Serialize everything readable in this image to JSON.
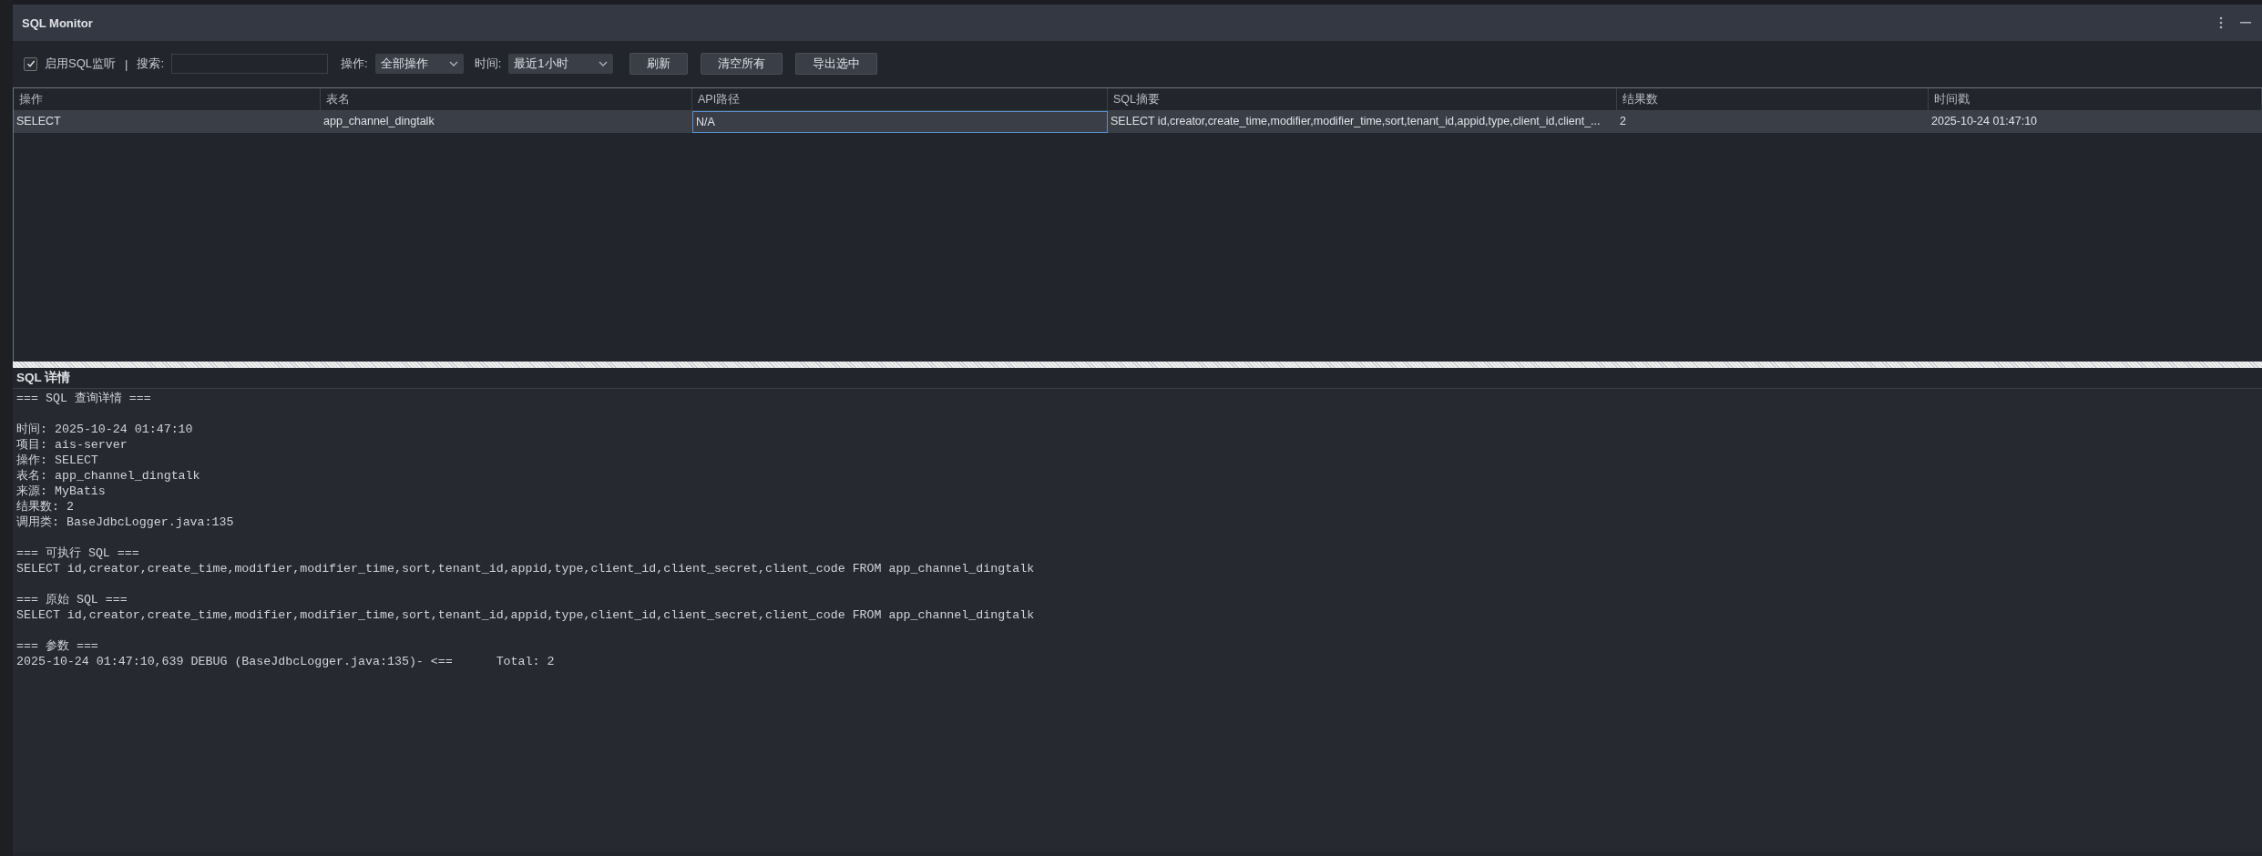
{
  "window": {
    "title": "SQL Monitor"
  },
  "toolbar": {
    "monitor": {
      "label": "启用SQL监听",
      "checked": true
    },
    "separator": "|",
    "search": {
      "label": "搜索:"
    },
    "operation": {
      "label": "操作:",
      "value": "全部操作"
    },
    "time": {
      "label": "时间:",
      "value": "最近1小时"
    },
    "buttons": [
      "刷新",
      "清空所有",
      "导出选中"
    ]
  },
  "table": {
    "columns": [
      "操作",
      "表名",
      "API路径",
      "SQL摘要",
      "结果数",
      "时间戳"
    ],
    "rows": [
      {
        "selected": true,
        "cells": [
          {
            "text": "SELECT",
            "focused": false
          },
          {
            "text": "app_channel_dingtalk",
            "focused": false
          },
          {
            "text": "N/A",
            "focused": true
          },
          {
            "text": "SELECT id,creator,create_time,modifier,modifier_time,sort,tenant_id,appid,type,client_id,client_...",
            "focused": false
          },
          {
            "text": "2",
            "focused": false
          },
          {
            "text": "2025-10-24 01:47:10",
            "focused": false
          }
        ]
      }
    ]
  },
  "details": {
    "title": "SQL 详情",
    "blocks": [
      [
        "=== SQL 查询详情 ==="
      ],
      [
        "时间: 2025-10-24 01:47:10",
        "项目: ais-server",
        "操作: SELECT",
        "表名: app_channel_dingtalk",
        "来源: MyBatis",
        "结果数: 2",
        "调用类: BaseJdbcLogger.java:135"
      ],
      [
        "=== 可执行 SQL ===",
        "SELECT id,creator,create_time,modifier,modifier_time,sort,tenant_id,appid,type,client_id,client_secret,client_code FROM app_channel_dingtalk"
      ],
      [
        "=== 原始 SQL ===",
        "SELECT id,creator,create_time,modifier,modifier_time,sort,tenant_id,appid,type,client_id,client_secret,client_code FROM app_channel_dingtalk"
      ],
      [
        "=== 参数 ===",
        "2025-10-24 01:47:10,639 DEBUG (BaseJdbcLogger.java:135)- <==      Total: 2"
      ]
    ]
  }
}
